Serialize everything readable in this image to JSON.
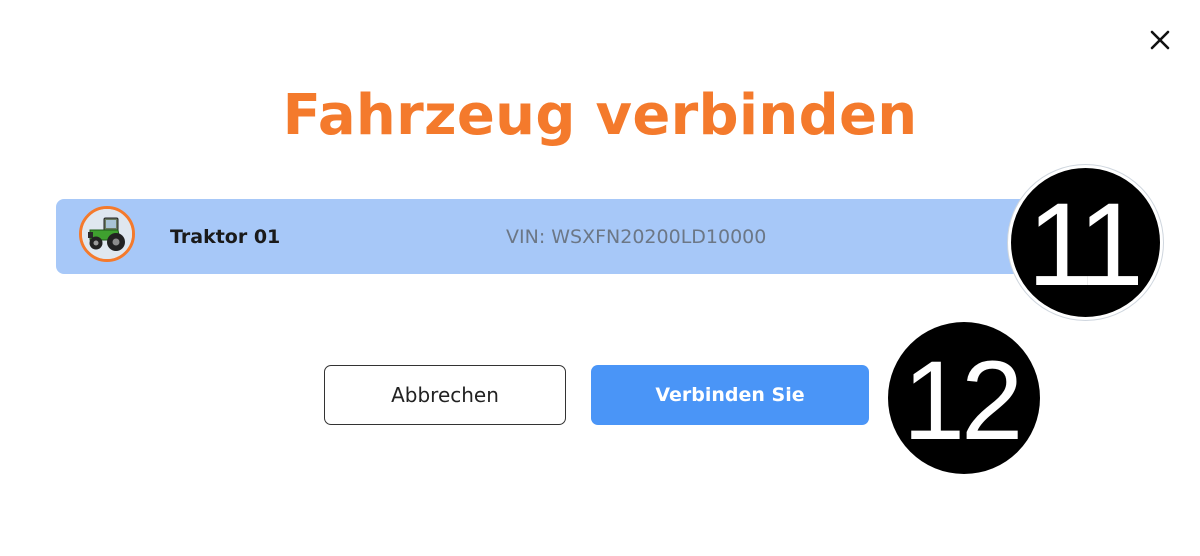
{
  "dialog": {
    "title": "Fahrzeug verbinden",
    "close_icon": "close-icon"
  },
  "vehicle": {
    "name": "Traktor 01",
    "vin": "VIN: WSXFN20200LD10000",
    "avatar_icon": "tractor-icon",
    "selected": true
  },
  "buttons": {
    "cancel_label": "Abbrechen",
    "connect_label": "Verbinden Sie"
  },
  "markers": {
    "vehicle_marker": "11",
    "connect_marker": "12"
  },
  "colors": {
    "title": "#f47a2c",
    "row_selected": "#a7c8f8",
    "primary_button": "#4a95f7",
    "avatar_border": "#f47a2c",
    "vin_text": "#6c7786"
  }
}
